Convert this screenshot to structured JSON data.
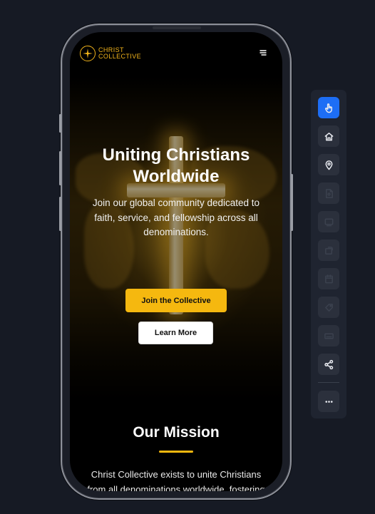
{
  "brand": {
    "line1": "CHRIST",
    "line2": "COLLECTIVE"
  },
  "header": {
    "menu_icon": "menu-icon"
  },
  "hero": {
    "title": "Uniting Christians Worldwide",
    "subtitle": "Join our global community dedicated to faith, service, and fellowship across all denominations.",
    "primary_button": "Join the Collective",
    "secondary_button": "Learn More"
  },
  "mission": {
    "title": "Our Mission",
    "text": "Christ Collective exists to unite Christians from all denominations worldwide, fostering"
  },
  "toolbar": {
    "items": [
      {
        "name": "pointer-tool",
        "icon": "hand-pointer-icon",
        "state": "active"
      },
      {
        "name": "home-tool",
        "icon": "home-icon",
        "state": "normal"
      },
      {
        "name": "location-tool",
        "icon": "map-pin-icon",
        "state": "normal"
      },
      {
        "name": "file-tool",
        "icon": "file-search-icon",
        "state": "disabled"
      },
      {
        "name": "screen-tool",
        "icon": "screen-icon",
        "state": "disabled"
      },
      {
        "name": "rotate-tool",
        "icon": "rotate-icon",
        "state": "disabled"
      },
      {
        "name": "calendar-tool",
        "icon": "calendar-icon",
        "state": "disabled"
      },
      {
        "name": "tag-tool",
        "icon": "tag-icon",
        "state": "disabled"
      },
      {
        "name": "keyboard-tool",
        "icon": "keyboard-icon",
        "state": "disabled"
      },
      {
        "name": "share-tool",
        "icon": "share-icon",
        "state": "normal"
      },
      {
        "name": "more-tool",
        "icon": "more-icon",
        "state": "normal"
      }
    ]
  },
  "colors": {
    "accent": "#f5b80f",
    "active_tool": "#1d6ef5",
    "page_background": "#161a24"
  }
}
